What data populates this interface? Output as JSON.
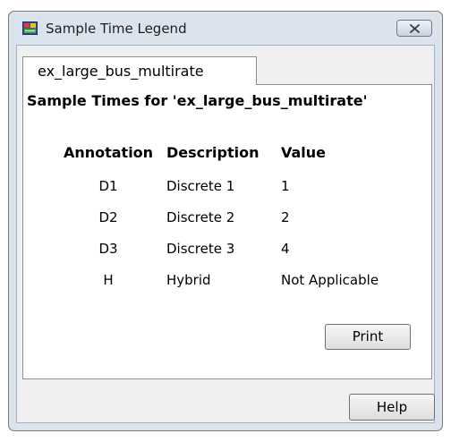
{
  "window": {
    "title": "Sample Time Legend",
    "close_symbol": "✕"
  },
  "icons": {
    "app": "simulink-model-icon",
    "close": "close-icon"
  },
  "tabs": [
    {
      "label": "ex_large_bus_multirate",
      "selected": true
    }
  ],
  "panel": {
    "heading": "Sample Times for 'ex_large_bus_multirate'",
    "table": {
      "headers": [
        "Annotation",
        "Description",
        "Value"
      ],
      "rows": [
        {
          "annotation": "D1",
          "description": "Discrete 1",
          "value": "1"
        },
        {
          "annotation": "D2",
          "description": "Discrete 2",
          "value": "2"
        },
        {
          "annotation": "D3",
          "description": "Discrete 3",
          "value": "4"
        },
        {
          "annotation": "H",
          "description": "Hybrid",
          "value": "Not Applicable"
        }
      ]
    },
    "print_label": "Print"
  },
  "footer": {
    "help_label": "Help"
  },
  "colors": {
    "frame": "#dbe3ec",
    "client": "#f0f0f0",
    "panel": "#ffffff"
  }
}
